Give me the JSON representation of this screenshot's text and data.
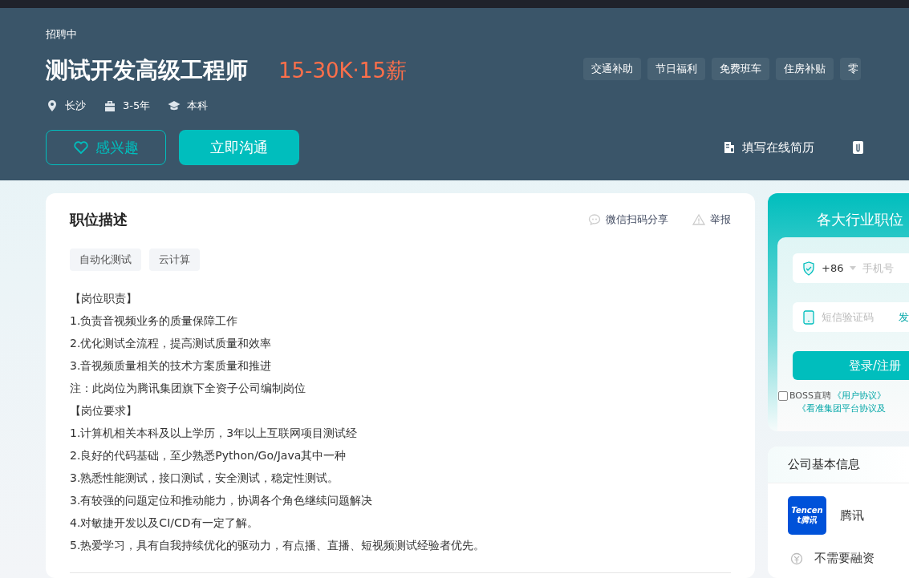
{
  "header": {
    "status": "招聘中",
    "title": "测试开发高级工程师",
    "salary": "15-30K·15薪",
    "meta": [
      {
        "kind": "location",
        "text": "长沙"
      },
      {
        "kind": "experience",
        "text": "3-5年"
      },
      {
        "kind": "degree",
        "text": "本科"
      }
    ],
    "benefits": [
      "交通补助",
      "节日福利",
      "免费班车",
      "住房补贴",
      "零"
    ],
    "buttons": [
      {
        "kind": "interest",
        "label": "感兴趣"
      },
      {
        "kind": "chat",
        "label": "立即沟通"
      }
    ],
    "links": [
      {
        "kind": "resume",
        "label": "填写在线简历"
      },
      {
        "kind": "attachment"
      }
    ]
  },
  "job": {
    "heading": "职位描述",
    "actions": [
      {
        "kind": "share",
        "label": "微信扫码分享"
      },
      {
        "kind": "report",
        "label": "举报"
      }
    ],
    "tags": [
      "自动化测试",
      "云计算"
    ],
    "description": [
      "【岗位职责】",
      "1.负责音视频业务的质量保障工作",
      "2.优化测试全流程，提高测试质量和效率",
      "3.音视频质量相关的技术方案质量和推进",
      "注：此岗位为腾讯集团旗下全资子公司编制岗位",
      "【岗位要求】",
      "1.计算机相关本科及以上学历，3年以上互联网项目测试经",
      "2.良好的代码基础，至少熟悉Python/Go/Java其中一种",
      "3.熟悉性能测试，接口测试，安全测试，稳定性测试。",
      "3.有较强的问题定位和推动能力，协调各个角色继续问题解决",
      "4.对敏捷开发以及CI/CD有一定了解。",
      "5.热爱学习，具有自我持续优化的驱动力，有点播、直播、短视频测试经验者优先。"
    ]
  },
  "login": {
    "title": "各大行业职位",
    "country_code": "+86",
    "phone_placeholder": "手机号",
    "code_placeholder": "短信验证码",
    "send_code": "发",
    "submit": "登录/注册",
    "agree_checked": false,
    "agreement": "BOSS直聘",
    "agreement_links": [
      "《用户协议》",
      "《看准集团平台协议及"
    ]
  },
  "company": {
    "heading": "公司基本信息",
    "logo_text": "Tencent腾讯",
    "name": "腾讯",
    "funding": "不需要融资"
  }
}
